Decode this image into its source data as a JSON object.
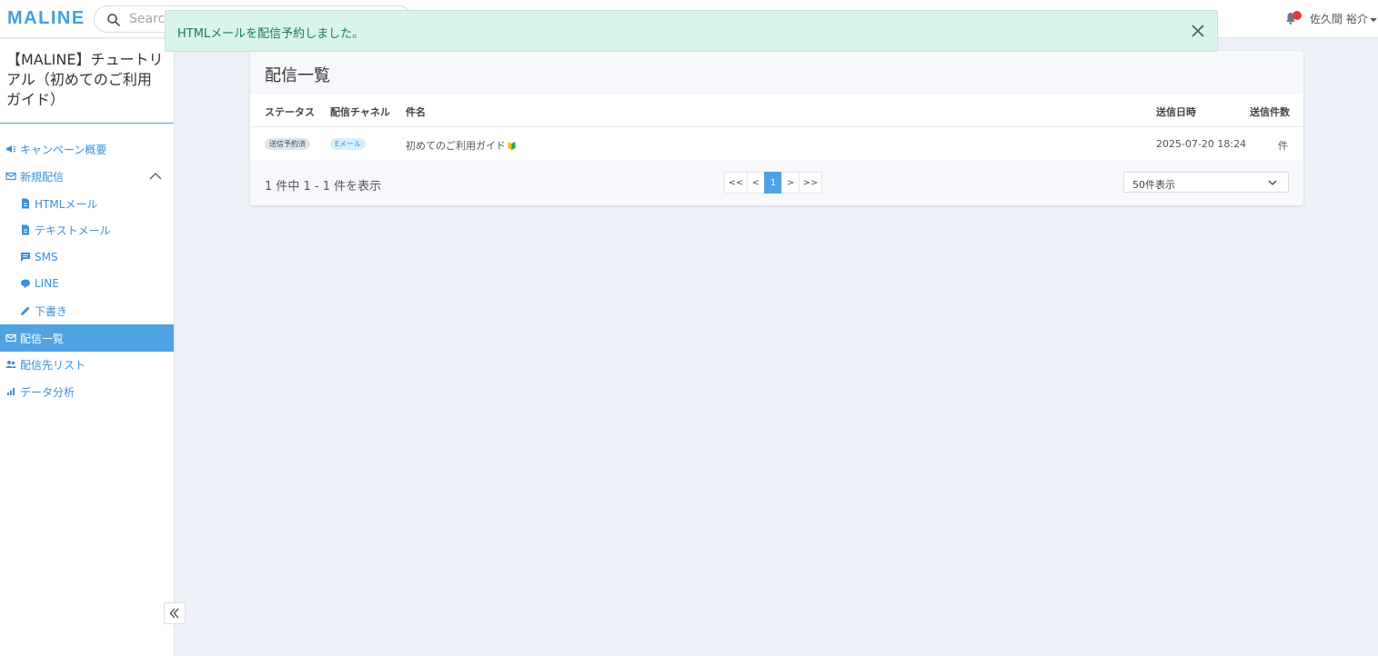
{
  "brand": {
    "logo_text": "MALINE"
  },
  "search": {
    "placeholder": "Search"
  },
  "user": {
    "name": "佐久間 裕介"
  },
  "toast": {
    "message": "HTMLメールを配信予約しました。"
  },
  "sidebar": {
    "campaign_title": "【MALINE】チュートリアル（初めてのご利用ガイド）",
    "items": [
      {
        "label": "キャンペーン概要",
        "icon": "megaphone-icon"
      },
      {
        "label": "新規配信",
        "icon": "mail-icon"
      },
      {
        "label": "HTMLメール",
        "icon": "document-icon"
      },
      {
        "label": "テキストメール",
        "icon": "document-icon"
      },
      {
        "label": "SMS",
        "icon": "chat-icon"
      },
      {
        "label": "LINE",
        "icon": "line-bubble-icon"
      },
      {
        "label": "下書き",
        "icon": "pencil-icon"
      },
      {
        "label": "配信一覧",
        "icon": "mail-icon",
        "active": true
      },
      {
        "label": "配信先リスト",
        "icon": "people-icon"
      },
      {
        "label": "データ分析",
        "icon": "bar-chart-icon"
      }
    ]
  },
  "page": {
    "title": "配信一覧",
    "columns": [
      "ステータス",
      "配信チャネル",
      "件名",
      "送信日時",
      "送信件数"
    ],
    "rows": [
      {
        "status": "送信予約済",
        "channel": "Eメール",
        "subject": "初めてのご利用ガイド",
        "sent_at": "2025-07-20 18:24",
        "count": "件"
      }
    ],
    "summary": "1 件中 1 - 1 件を表示",
    "pagination": {
      "first": "<<",
      "prev": "<",
      "current": "1",
      "next": ">",
      "last": ">>"
    },
    "per_page": "50件表示"
  },
  "colors": {
    "accent": "#4fa3e3",
    "toast_bg": "#d9f5e9",
    "toast_text": "#1d7a55",
    "notification": "#e53935"
  }
}
